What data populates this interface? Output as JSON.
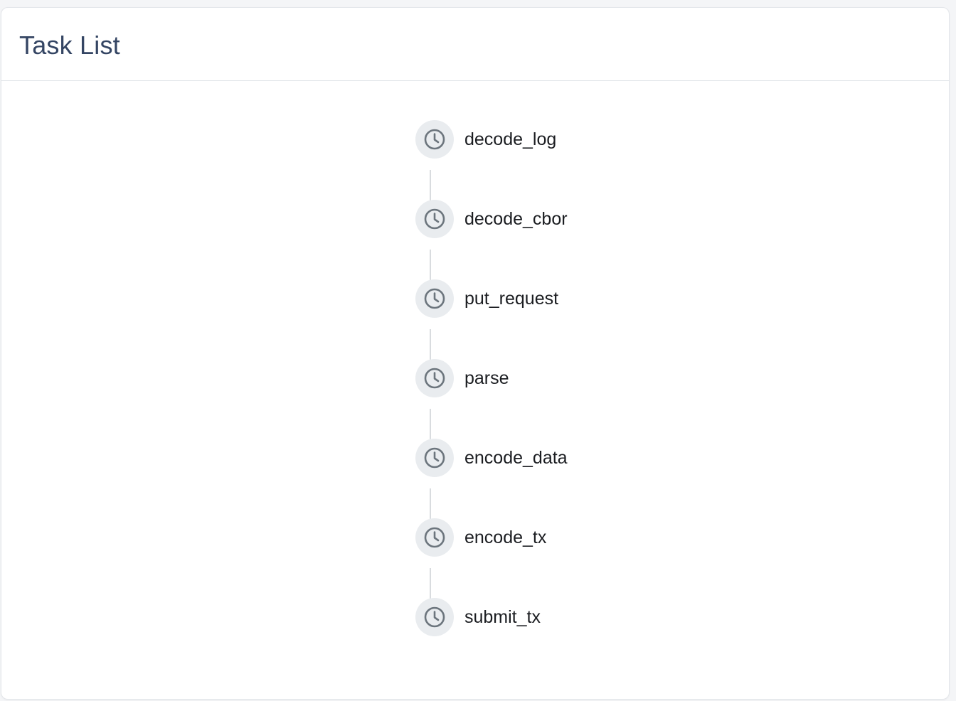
{
  "panel": {
    "title": "Task List"
  },
  "tasks": [
    {
      "name": "decode_log",
      "icon": "clock-icon",
      "status": "pending"
    },
    {
      "name": "decode_cbor",
      "icon": "clock-icon",
      "status": "pending"
    },
    {
      "name": "put_request",
      "icon": "clock-icon",
      "status": "pending"
    },
    {
      "name": "parse",
      "icon": "clock-icon",
      "status": "pending"
    },
    {
      "name": "encode_data",
      "icon": "clock-icon",
      "status": "pending"
    },
    {
      "name": "encode_tx",
      "icon": "clock-icon",
      "status": "pending"
    },
    {
      "name": "submit_tx",
      "icon": "clock-icon",
      "status": "pending"
    }
  ],
  "colors": {
    "title": "#344563",
    "icon_circle": "#e9ecef",
    "icon_stroke": "#6c757d",
    "connector": "#d9dcdf",
    "label": "#1b1d21"
  }
}
